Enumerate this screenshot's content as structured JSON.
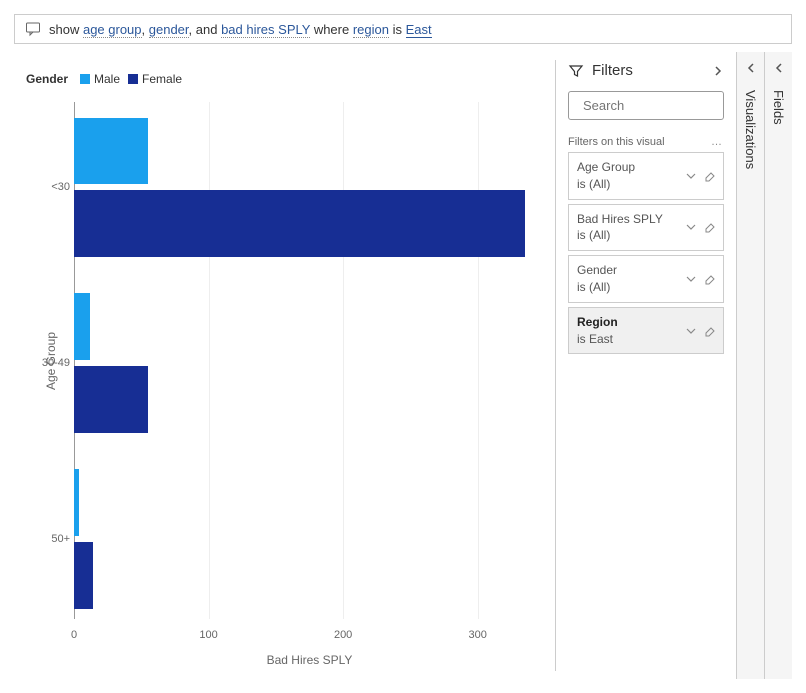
{
  "query": {
    "prefix": "show ",
    "token_age_group": "age group",
    "sep1": ", ",
    "token_gender": "gender",
    "sep2": ", and ",
    "token_bad_hires": "bad hires SPLY",
    "sep3": " where ",
    "token_region": "region",
    "sep4": " is ",
    "token_east": "East"
  },
  "chart": {
    "legend_title": "Gender",
    "legend_male": "Male",
    "legend_female": "Female",
    "y_axis": "Age Group",
    "x_axis": "Bad Hires SPLY",
    "x_ticks": {
      "t0": "0",
      "t100": "100",
      "t200": "200",
      "t300": "300"
    },
    "cats": {
      "c0": "<30",
      "c1": "30-49",
      "c2": "50+"
    }
  },
  "chart_data": {
    "type": "bar",
    "orientation": "horizontal_grouped",
    "categories": [
      "<30",
      "30-49",
      "50+"
    ],
    "series": [
      {
        "name": "Male",
        "color": "#1aa0ed",
        "values": [
          55,
          12,
          4
        ]
      },
      {
        "name": "Female",
        "color": "#172e94",
        "values": [
          335,
          55,
          14
        ]
      }
    ],
    "xlabel": "Bad Hires SPLY",
    "ylabel": "Age Group",
    "xlim": [
      0,
      350
    ],
    "legend_title": "Gender",
    "legend_position": "top-left"
  },
  "filters": {
    "title": "Filters",
    "search_placeholder": "Search",
    "section_label": "Filters on this visual",
    "cards": {
      "age_group": {
        "field": "Age Group",
        "status": "is (All)"
      },
      "bad_hires": {
        "field": "Bad Hires SPLY",
        "status": "is (All)"
      },
      "gender": {
        "field": "Gender",
        "status": "is (All)"
      },
      "region": {
        "field": "Region",
        "status": "is East"
      }
    }
  },
  "rails": {
    "visualizations": "Visualizations",
    "fields": "Fields"
  }
}
